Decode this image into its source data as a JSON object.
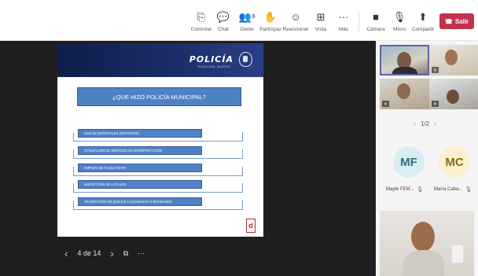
{
  "toolbar": {
    "buttons": [
      {
        "label": "Controlar",
        "icon": "control-icon",
        "glyph": "⎘"
      },
      {
        "label": "Chat",
        "icon": "chat-icon",
        "glyph": "💬"
      },
      {
        "label": "Gente",
        "icon": "people-icon",
        "glyph": "👥",
        "count": "8"
      },
      {
        "label": "Participar",
        "icon": "raise-hand-icon",
        "glyph": "✋"
      },
      {
        "label": "Reaccionar",
        "icon": "react-icon",
        "glyph": "☺"
      },
      {
        "label": "Vista",
        "icon": "view-icon",
        "glyph": "⊞"
      },
      {
        "label": "Más",
        "icon": "more-icon",
        "glyph": "···"
      },
      {
        "label": "Cámara",
        "icon": "camera-icon",
        "glyph": "■"
      },
      {
        "label": "Micro",
        "icon": "mic-off-icon",
        "glyph": "🎙"
      },
      {
        "label": "Compartir",
        "icon": "share-icon",
        "glyph": "⬆"
      }
    ],
    "leave_label": "Salir",
    "leave_color": "#c4314b"
  },
  "slide": {
    "logo_text": "POLICÍA",
    "logo_subtext": "MUNICIPAL MADRID",
    "question": "¿QUE HIZO POLICÍA MUNICIPAL?",
    "items": [
      "USO DE MATERIALES ADAPTADOS",
      "UTILIZACIÓN DE SERVICIO DE INTERPRETACIÓN",
      "EMPLEO DE FACILITADOR",
      "INSPECCIÓN DE LOCALES",
      "TRAMITACIÓN DE QUEJAS CIUDADANAS O ENTIDADES"
    ],
    "accent_color": "#4f81c7",
    "badge_text": "d"
  },
  "slide_nav": {
    "page_label": "4 de 14",
    "prev_icon": "chevron-left-icon",
    "next_icon": "chevron-right-icon"
  },
  "participants": {
    "pager": "1/2",
    "people": [
      {
        "initials": "MF",
        "name": "Mayte FEM..."
      },
      {
        "initials": "MC",
        "name": "María Caba..."
      }
    ]
  }
}
